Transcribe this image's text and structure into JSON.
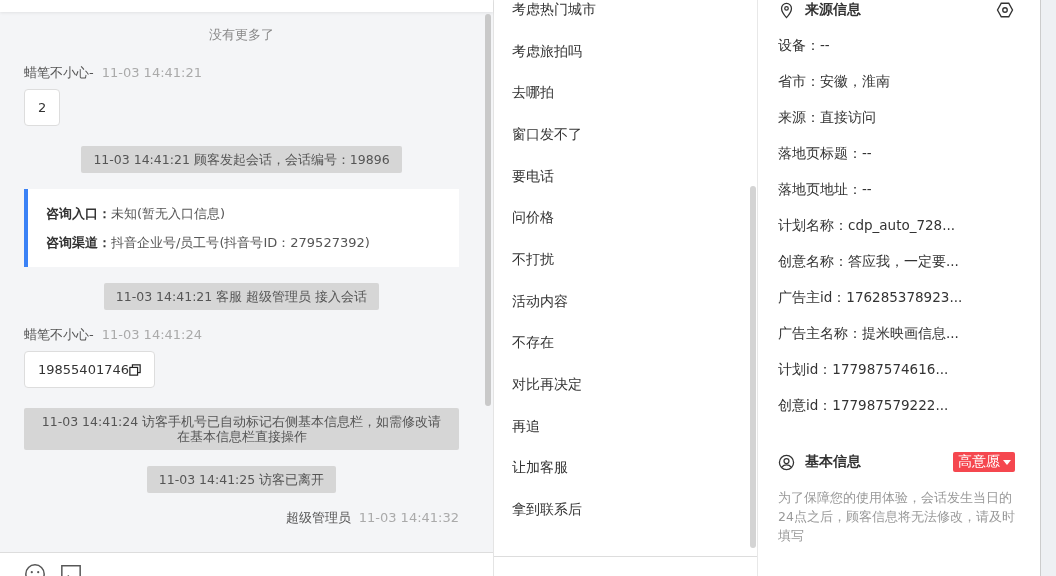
{
  "chat": {
    "no_more": "没有更多了",
    "messages": [
      {
        "kind": "visitor",
        "sender": "蜡笔不小心-",
        "time": "11-03 14:41:21",
        "text": "2",
        "copyable": false
      },
      {
        "kind": "system",
        "text": "11-03 14:41:21 顾客发起会话，会话编号：19896"
      },
      {
        "kind": "info",
        "lines": [
          {
            "label": "咨询入口：",
            "value": "未知(暂无入口信息)"
          },
          {
            "label": "咨询渠道：",
            "value": "抖音企业号/员工号(抖音号ID：279527392)"
          }
        ]
      },
      {
        "kind": "system",
        "text": "11-03 14:41:21 客服 超级管理员 接入会话"
      },
      {
        "kind": "visitor",
        "sender": "蜡笔不小心-",
        "time": "11-03 14:41:24",
        "text": "19855401746",
        "copyable": true
      },
      {
        "kind": "system",
        "text": "11-03 14:41:24 访客手机号已自动标记右侧基本信息栏，如需修改请在基本信息栏直接操作"
      },
      {
        "kind": "system",
        "text": "11-03 14:41:25 访客已离开"
      },
      {
        "kind": "agent",
        "sender": "超级管理员",
        "time": "11-03 14:41:32"
      }
    ]
  },
  "phrases": [
    "考虑热门城市",
    "考虑旅拍吗",
    "去哪拍",
    "窗口发不了",
    "要电话",
    "问价格",
    "不打扰",
    "活动内容",
    "不存在",
    "对比再决定",
    "再追",
    "让加客服",
    "拿到联系后"
  ],
  "source_info": {
    "title": "来源信息",
    "fields": [
      "设备：--",
      "省市：安徽，淮南",
      "来源：直接访问",
      "落地页标题：--",
      "落地页地址：--",
      "计划名称：cdp_auto_728...",
      "创意名称：答应我，一定要...",
      "广告主id：176285378923...",
      "广告主名称：提米映画信息...",
      "计划id：177987574616...",
      "创意id：177987579222..."
    ]
  },
  "basic_info": {
    "title": "基本信息",
    "intent": {
      "label": "高意愿",
      "color": "#f5474f"
    },
    "notice": "为了保障您的使用体验，会话发生当日的24点之后，顾客信息将无法修改，请及时填写"
  }
}
